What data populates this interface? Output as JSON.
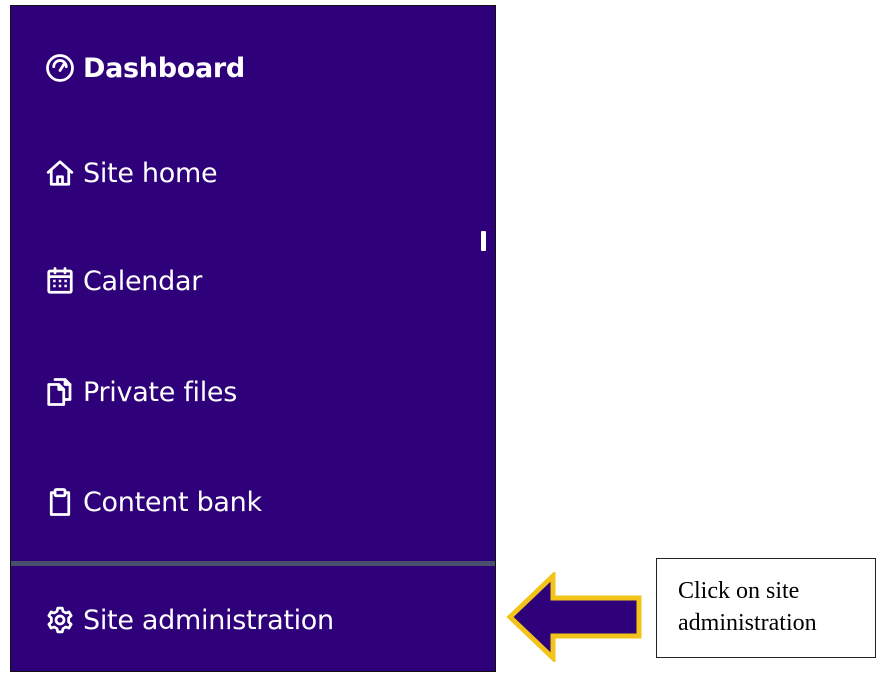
{
  "sidebar": {
    "items": [
      {
        "label": "Dashboard",
        "icon": "gauge-icon"
      },
      {
        "label": "Site home",
        "icon": "home-icon"
      },
      {
        "label": "Calendar",
        "icon": "calendar-icon"
      },
      {
        "label": "Private files",
        "icon": "files-icon"
      },
      {
        "label": "Content bank",
        "icon": "clipboard-icon"
      },
      {
        "label": "Site administration",
        "icon": "gear-icon"
      }
    ],
    "background_color": "#2e007a",
    "text_color": "#ffffff"
  },
  "callout": {
    "line1": "Click on site",
    "line2": "administration"
  },
  "arrow": {
    "fill_color": "#2e007a",
    "outline_color": "#f2c318",
    "direction": "left"
  }
}
